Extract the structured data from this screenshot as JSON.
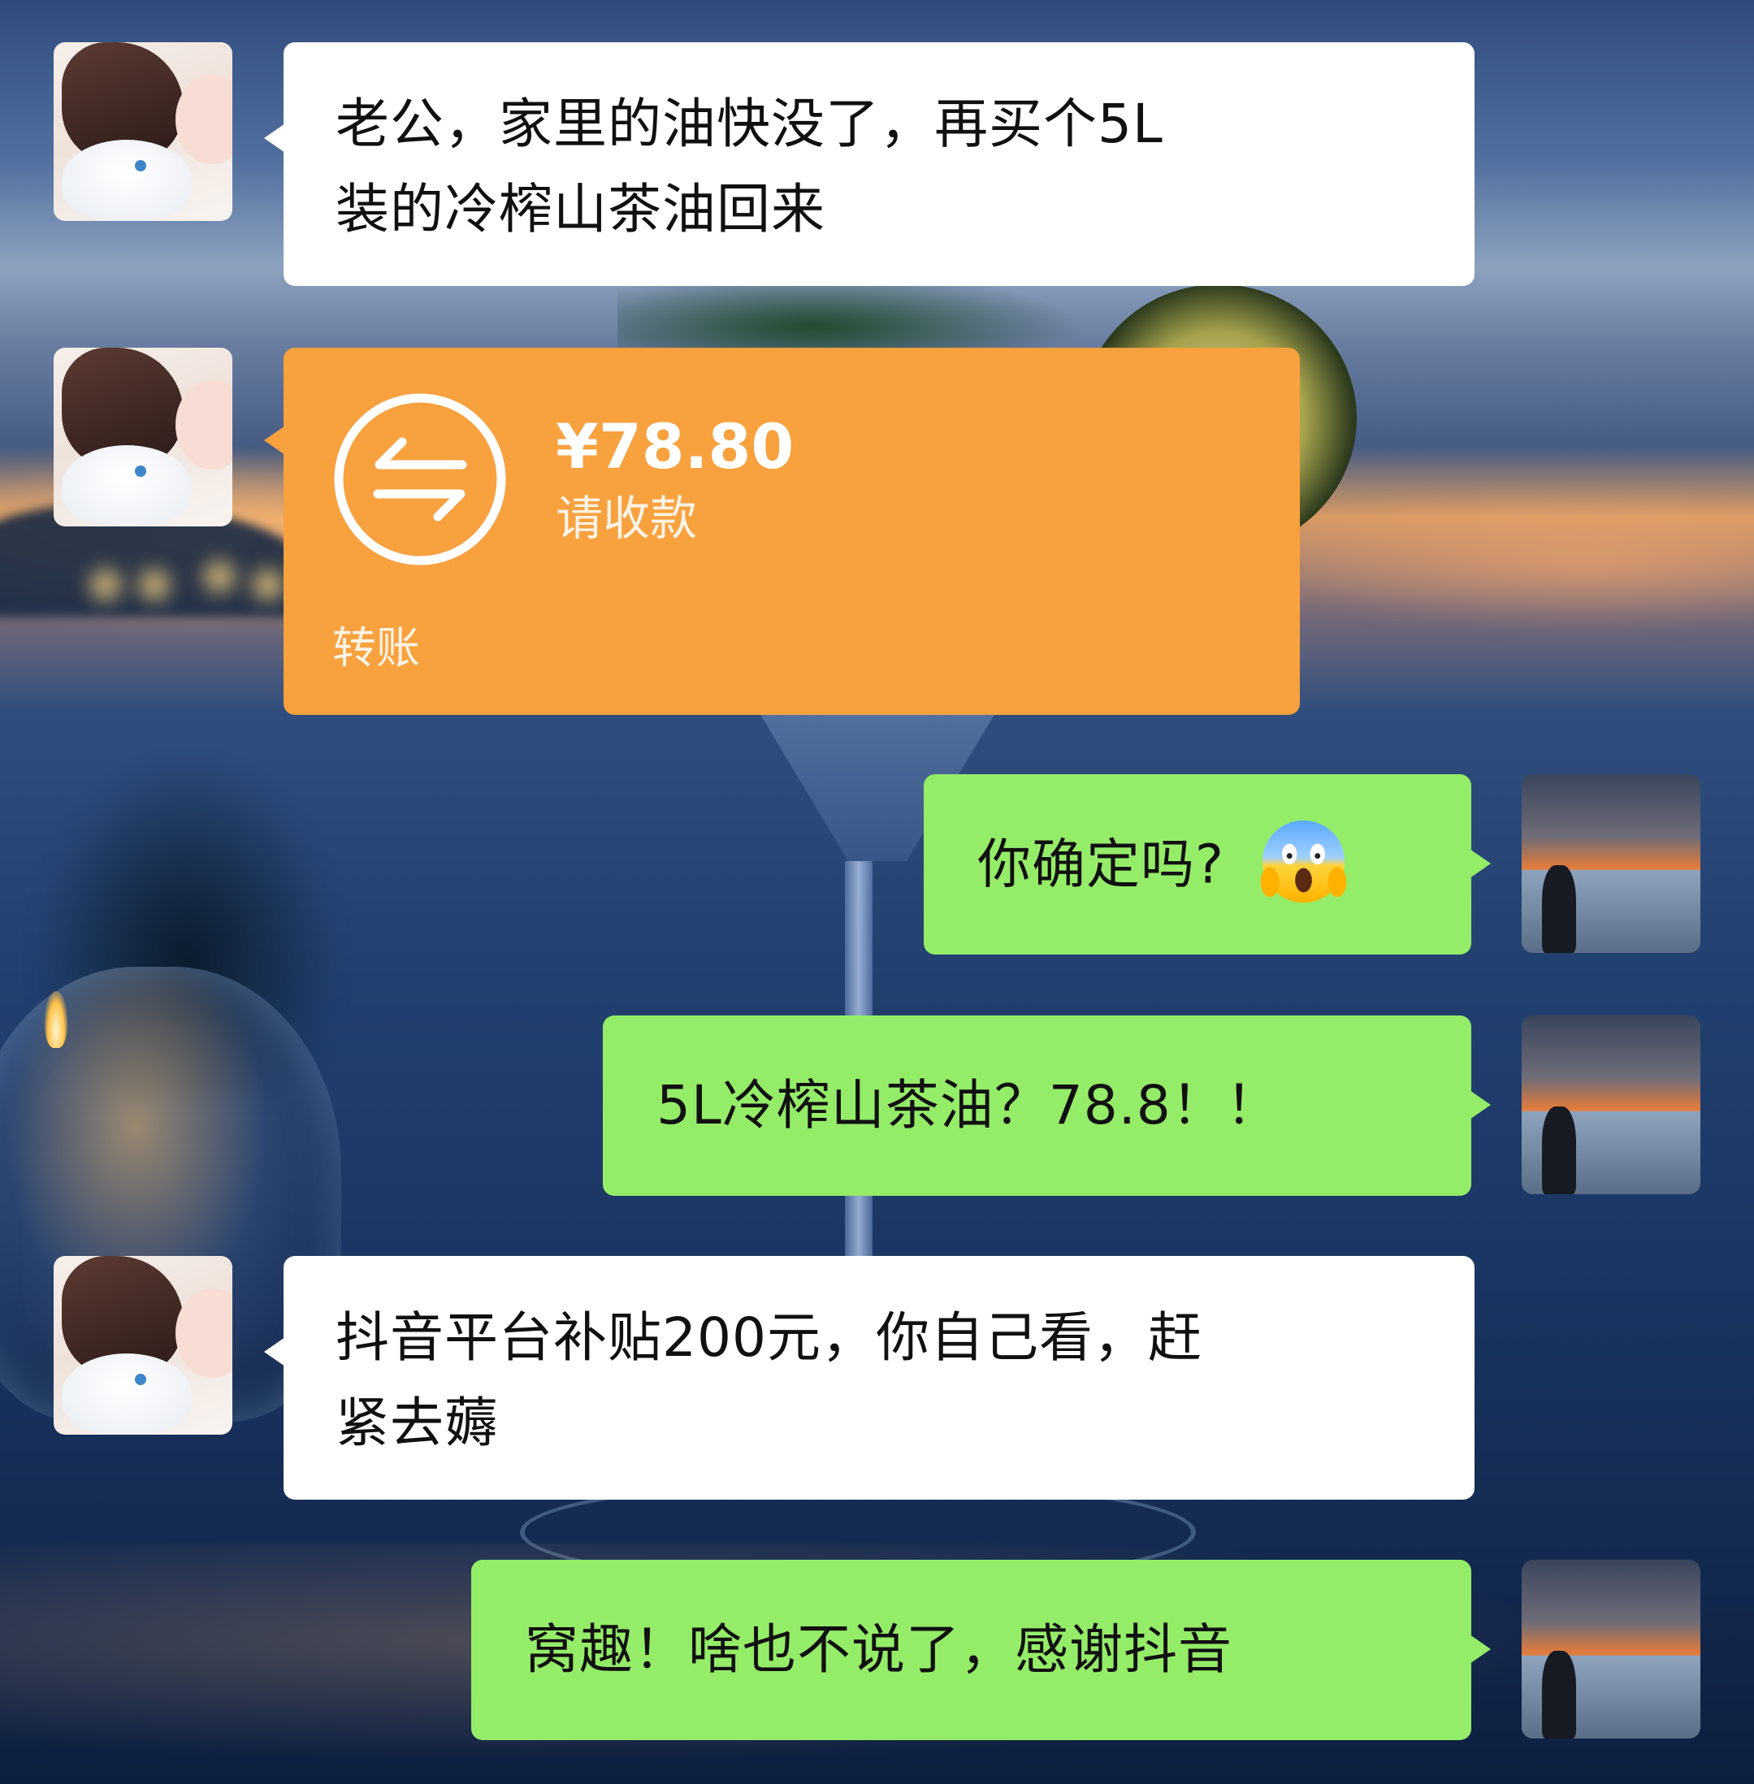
{
  "messages": [
    {
      "sender": "wife",
      "type": "text",
      "line1": "老公，家里的油快没了，再买个5L",
      "line2": "装的冷榨山茶油回来"
    },
    {
      "sender": "wife",
      "type": "transfer",
      "amount": "¥78.80",
      "status": "请收款",
      "label": "转账",
      "icon": "transfer-arrows-icon",
      "color": "#f8a13f"
    },
    {
      "sender": "me",
      "type": "text",
      "text": "你确定吗?",
      "emoji": "scream-emoji"
    },
    {
      "sender": "me",
      "type": "text",
      "text": "5L冷榨山茶油？78.8！！"
    },
    {
      "sender": "wife",
      "type": "text",
      "line1": "抖音平台补贴200元，你自己看，赶",
      "line2": "紧去薅"
    },
    {
      "sender": "me",
      "type": "text",
      "text": "窝趣！啥也不说了，感谢抖音"
    }
  ],
  "colors": {
    "incoming_bubble": "#ffffff",
    "outgoing_bubble": "#95ec69",
    "transfer_card": "#f8a13f"
  },
  "avatars": {
    "wife": "girl-with-cat-avatar",
    "me": "sunset-silhouette-avatar"
  }
}
